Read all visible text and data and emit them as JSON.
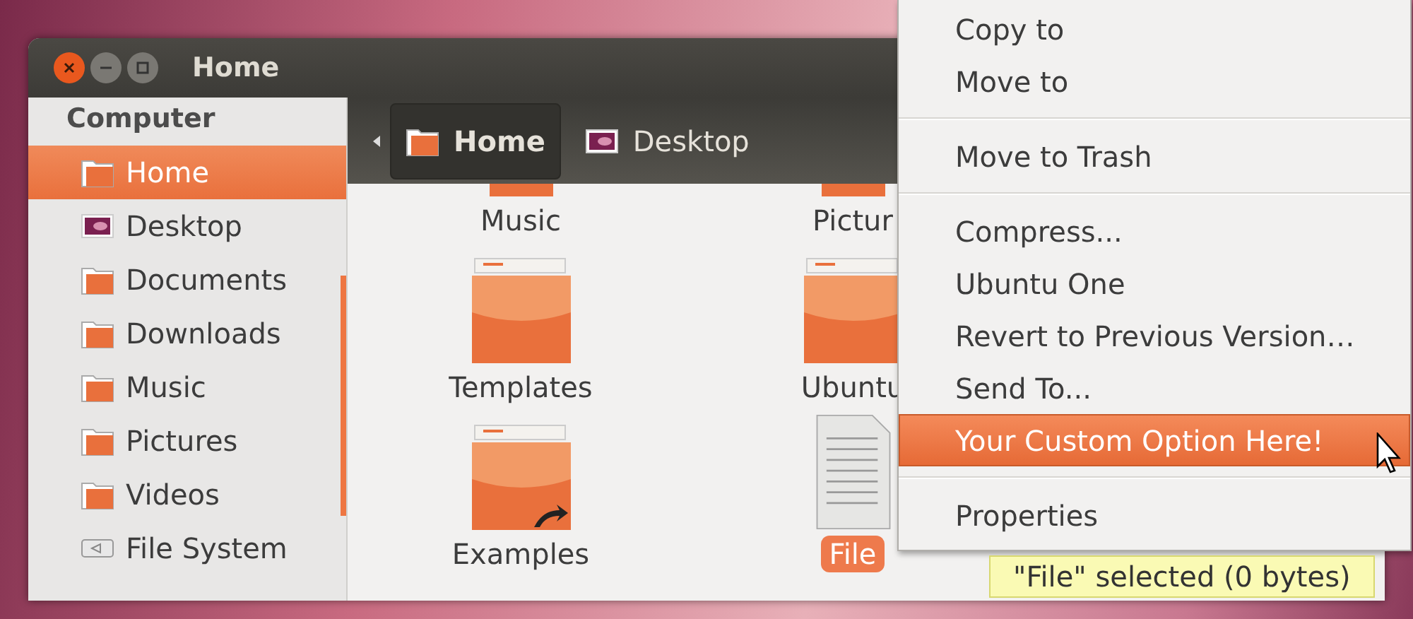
{
  "window": {
    "title": "Home"
  },
  "sidebar": {
    "heading": "Computer",
    "items": [
      {
        "label": "Home",
        "selected": true
      },
      {
        "label": "Desktop",
        "selected": false
      },
      {
        "label": "Documents",
        "selected": false
      },
      {
        "label": "Downloads",
        "selected": false
      },
      {
        "label": "Music",
        "selected": false
      },
      {
        "label": "Pictures",
        "selected": false
      },
      {
        "label": "Videos",
        "selected": false
      },
      {
        "label": "File System",
        "selected": false
      }
    ]
  },
  "path_bar": {
    "items": [
      {
        "label": "Home",
        "selected": true
      },
      {
        "label": "Desktop",
        "selected": false
      }
    ]
  },
  "files": [
    {
      "name": "Music",
      "kind": "folder",
      "selected": false
    },
    {
      "name": "Pictur",
      "kind": "folder",
      "selected": false
    },
    {
      "name": "Templates",
      "kind": "folder",
      "selected": false
    },
    {
      "name": "Ubuntu",
      "kind": "folder",
      "selected": false
    },
    {
      "name": "Examples",
      "kind": "link",
      "selected": false
    },
    {
      "name": "File",
      "kind": "file",
      "selected": true
    }
  ],
  "context_menu": {
    "items": [
      {
        "kind": "item",
        "label": "Copy to",
        "selected": false
      },
      {
        "kind": "item",
        "label": "Move to",
        "selected": false
      },
      {
        "kind": "separator"
      },
      {
        "kind": "item",
        "label": "Move to Trash",
        "selected": false
      },
      {
        "kind": "separator"
      },
      {
        "kind": "item",
        "label": "Compress...",
        "selected": false
      },
      {
        "kind": "item",
        "label": "Ubuntu One",
        "selected": false
      },
      {
        "kind": "item",
        "label": "Revert to Previous Version…",
        "selected": false
      },
      {
        "kind": "item",
        "label": "Send To...",
        "selected": false
      },
      {
        "kind": "item",
        "label": "Your Custom Option Here!",
        "selected": true
      },
      {
        "kind": "separator"
      },
      {
        "kind": "item",
        "label": "Properties",
        "selected": false
      }
    ]
  },
  "status": "\"File\" selected (0 bytes)"
}
